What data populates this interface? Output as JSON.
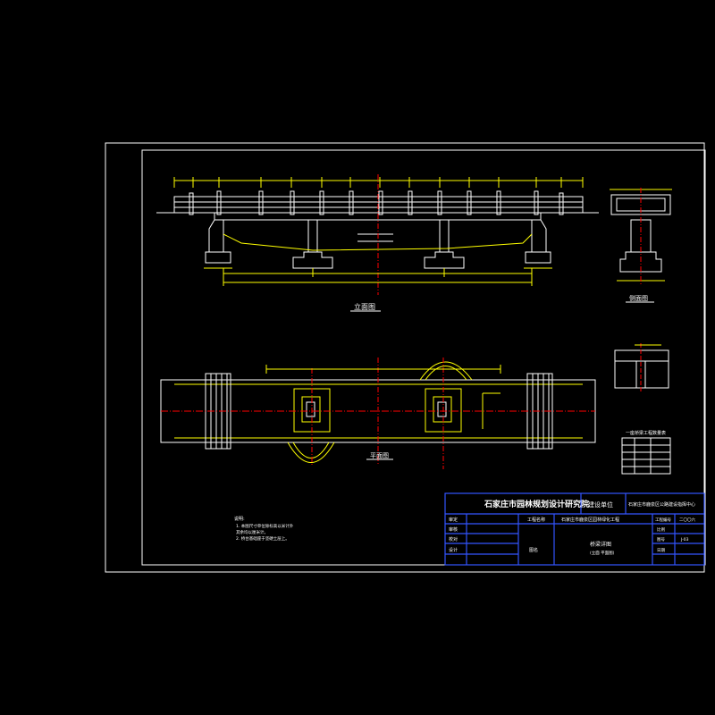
{
  "views": {
    "elevation_label": "立面图",
    "plan_label": "平面图",
    "side_label": "侧面图"
  },
  "title_block": {
    "institute": "石家庄市园林规划设计研究院",
    "client_label": "建设单位",
    "client": "石家庄市鹿泉区公路建设指挥中心",
    "approve": "审定",
    "review": "审核",
    "check": "校对",
    "design": "设计",
    "project_label": "工程名称",
    "project": "石家庄市鹿泉区园林绿化工程",
    "drawing_label": "图名",
    "drawing_title": "桥梁详图",
    "drawing_subtitle": "(立面 平面图)",
    "phase_label": "工程编号",
    "phase": "二〇〇六",
    "sheet_label": "图号",
    "sheet_no": "J-03",
    "date_label": "日期",
    "scale_label": "比例"
  },
  "notes": {
    "heading": "说明:",
    "lines": [
      "1. 本图尺寸单位除标高以米计外",
      "   其余均以厘米计。",
      "2. 桥台基础座于坚硬土层上。"
    ]
  },
  "table": {
    "title": "一座桥梁工程数量表"
  }
}
